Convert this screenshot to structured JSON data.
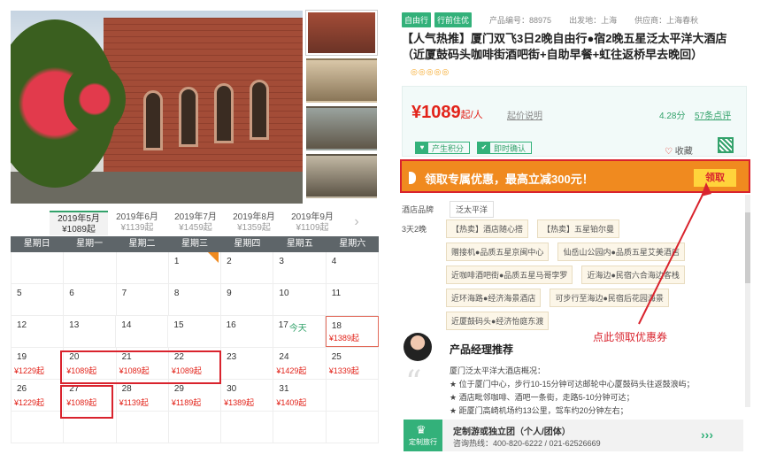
{
  "calendar": {
    "months": [
      {
        "label": "2019年5月",
        "price": "¥1089起",
        "active": true
      },
      {
        "label": "2019年6月",
        "price": "¥1139起"
      },
      {
        "label": "2019年7月",
        "price": "¥1459起"
      },
      {
        "label": "2019年8月",
        "price": "¥1359起"
      },
      {
        "label": "2019年9月",
        "price": "¥1109起"
      }
    ],
    "next_icon": "›",
    "weekdays": [
      "星期日",
      "星期一",
      "星期二",
      "星期三",
      "星期四",
      "星期五",
      "星期六"
    ],
    "weeks": [
      [
        {
          "d": ""
        },
        {
          "d": ""
        },
        {
          "d": ""
        },
        {
          "d": "1",
          "corner": true
        },
        {
          "d": "2"
        },
        {
          "d": "3"
        },
        {
          "d": "4"
        }
      ],
      [
        {
          "d": "5"
        },
        {
          "d": "6"
        },
        {
          "d": "7"
        },
        {
          "d": "8"
        },
        {
          "d": "9"
        },
        {
          "d": "10"
        },
        {
          "d": "11"
        }
      ],
      [
        {
          "d": "12"
        },
        {
          "d": "13"
        },
        {
          "d": "14"
        },
        {
          "d": "15"
        },
        {
          "d": "16"
        },
        {
          "d": "17",
          "today": "今天"
        },
        {
          "d": "18",
          "p": "¥1389起",
          "sel": true
        }
      ],
      [
        {
          "d": "19",
          "p": "¥1229起"
        },
        {
          "d": "20",
          "p": "¥1089起"
        },
        {
          "d": "21",
          "p": "¥1089起"
        },
        {
          "d": "22",
          "p": "¥1089起"
        },
        {
          "d": "23"
        },
        {
          "d": "24",
          "p": "¥1429起"
        },
        {
          "d": "25",
          "p": "¥1339起"
        }
      ],
      [
        {
          "d": "26",
          "p": "¥1229起"
        },
        {
          "d": "27",
          "p": "¥1089起"
        },
        {
          "d": "28",
          "p": "¥1139起"
        },
        {
          "d": "29",
          "p": "¥1189起"
        },
        {
          "d": "30",
          "p": "¥1389起"
        },
        {
          "d": "31",
          "p": "¥1409起"
        },
        {
          "d": ""
        }
      ],
      [
        {
          "d": ""
        },
        {
          "d": ""
        },
        {
          "d": ""
        },
        {
          "d": ""
        },
        {
          "d": ""
        },
        {
          "d": ""
        },
        {
          "d": ""
        }
      ]
    ]
  },
  "product": {
    "badge1": "自由行",
    "badge2": "行前住优",
    "code_label": "产品编号：88975",
    "departure": "出发地：上海",
    "supplier": "供应商：上海春秋",
    "title": "【人气热推】厦门双飞3日2晚自由行●宿2晚五星泛太平洋大酒店（近厦鼓码头咖啡街酒吧街+自助早餐+虹往返桥早去晚回）",
    "rating_icons": "◎◎◎◎◎",
    "price_num": "¥1089",
    "price_unit": "起/人",
    "price_help": "起价说明",
    "score": "4.28分",
    "reviews": "57条点评",
    "tag1_icon": "♥",
    "tag1": "产生积分",
    "tag2_icon": "✔",
    "tag2": "即时确认",
    "fav_icon": "♡",
    "fav": "收藏",
    "promo_text": "领取专属优惠，最高立减300元！",
    "promo_btn": "领取",
    "brand_label": "酒店品牌",
    "brand": "泛太平洋",
    "itin_label": "3天2晚",
    "itin_rows": [
      [
        "【热卖】酒店随心搭",
        "【热卖】五星铂尔曼"
      ],
      [
        "赠接机●品质五星京闽中心",
        "仙岳山公园内●品质五星艾美酒店"
      ],
      [
        "近咖啡酒吧街●品质五星马哥孛罗",
        "近海边●民宿六合海边客栈"
      ],
      [
        "近环海路●经济海景酒店",
        "可步行至海边●民宿后花园海景"
      ],
      [
        "近厦鼓码头●经济怡庭东渡"
      ]
    ],
    "pm_title": "产品经理推荐",
    "pm_lines": [
      "厦门泛太平洋大酒店概况：",
      "★ 位于厦门中心，步行10-15分钟可达邮轮中心厦鼓码头往返鼓浪屿；",
      "★ 酒店毗邻咖啡、酒吧一条街，走路5-10分钟可达；",
      "★ 距厦门高崎机场约13公里，驾车约20分钟左右；"
    ],
    "annotation": "点此领取优惠券",
    "custom_logo": "定制旅行",
    "custom_t1": "定制游或独立团（个人/团体）",
    "custom_t2": "咨询热线：400-820-6222 / 021-62526669",
    "custom_go": "›››"
  },
  "colors": {
    "accent": "#33b17a",
    "price": "#e2231a",
    "promo": "#f08a1f",
    "annot": "#d9232d"
  }
}
